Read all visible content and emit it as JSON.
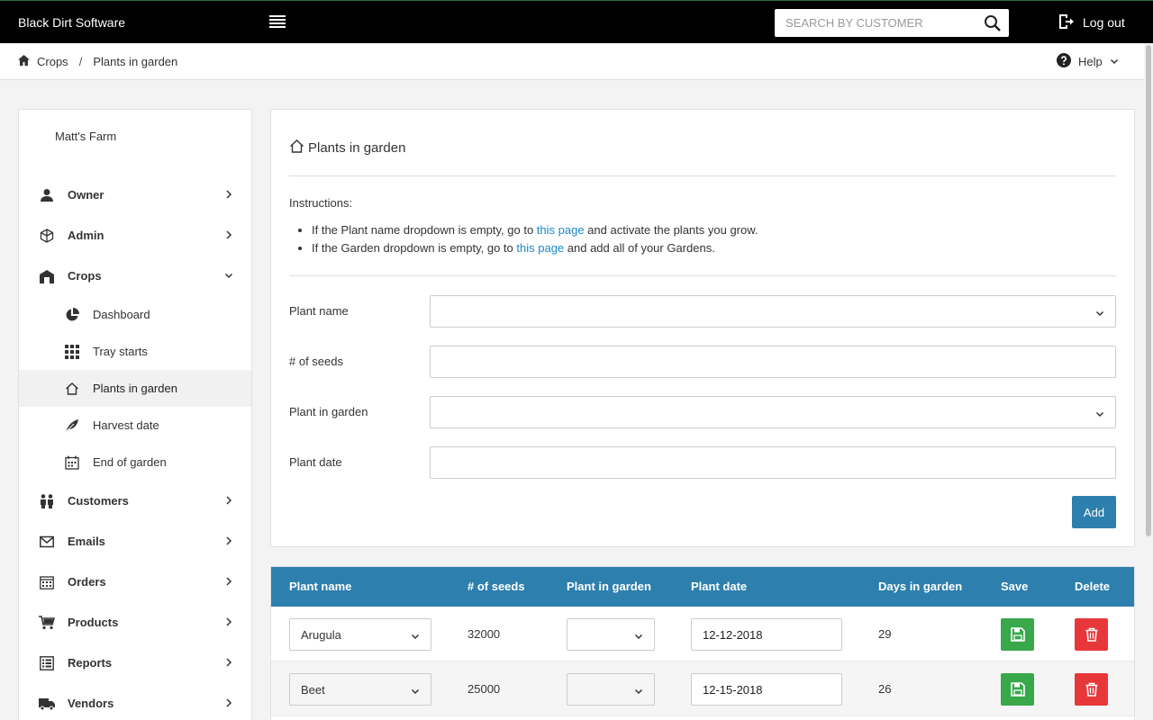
{
  "app": {
    "brand": "Black Dirt Software"
  },
  "header": {
    "search_placeholder": "SEARCH BY CUSTOMER",
    "logout_label": "Log out",
    "help_label": "Help"
  },
  "breadcrumb": {
    "home": "Crops",
    "separator": "/",
    "current": "Plants in garden"
  },
  "sidebar": {
    "farm_name": "Matt's Farm",
    "items": [
      {
        "label": "Owner",
        "icon": "user-icon"
      },
      {
        "label": "Admin",
        "icon": "cube-icon"
      },
      {
        "label": "Crops",
        "icon": "barn-icon",
        "expanded": true
      },
      {
        "label": "Customers",
        "icon": "people-icon"
      },
      {
        "label": "Emails",
        "icon": "envelope-icon"
      },
      {
        "label": "Orders",
        "icon": "calendar-grid-icon"
      },
      {
        "label": "Products",
        "icon": "cart-icon"
      },
      {
        "label": "Reports",
        "icon": "list-icon"
      },
      {
        "label": "Vendors",
        "icon": "truck-icon"
      }
    ],
    "crops_sub": [
      {
        "label": "Dashboard",
        "icon": "pie-chart-icon"
      },
      {
        "label": "Tray starts",
        "icon": "grid-icon"
      },
      {
        "label": "Plants in garden",
        "icon": "house-icon",
        "active": true
      },
      {
        "label": "Harvest date",
        "icon": "leaf-icon"
      },
      {
        "label": "End of garden",
        "icon": "calendar-icon"
      }
    ]
  },
  "panel": {
    "title": "Plants in garden",
    "instructions_label": "Instructions:",
    "instruction_1": {
      "before": "If the Plant name dropdown is empty, go to ",
      "link": "this page",
      "after": " and activate the plants you grow."
    },
    "instruction_2": {
      "before": "If the Garden dropdown is empty, go to ",
      "link": "this page",
      "after": " and add all of your Gardens."
    },
    "form": {
      "plant_name_label": "Plant name",
      "plant_name_value": "",
      "seeds_label": "# of seeds",
      "seeds_value": "",
      "garden_label": "Plant in garden",
      "garden_value": "",
      "date_label": "Plant date",
      "date_value": "",
      "add_label": "Add"
    }
  },
  "table": {
    "headers": [
      "Plant name",
      "# of seeds",
      "Plant in garden",
      "Plant date",
      "Days in garden",
      "Save",
      "Delete"
    ],
    "rows": [
      {
        "plant": "Arugula",
        "seeds": "32000",
        "garden": "",
        "date": "12-12-2018",
        "days": "29"
      },
      {
        "plant": "Beet",
        "seeds": "25000",
        "garden": "",
        "date": "12-15-2018",
        "days": "26"
      }
    ]
  },
  "colors": {
    "topbar": "#000000",
    "accent": "#2d7fad",
    "save": "#38a84b",
    "delete": "#e8373a",
    "link": "#1c87c9"
  }
}
